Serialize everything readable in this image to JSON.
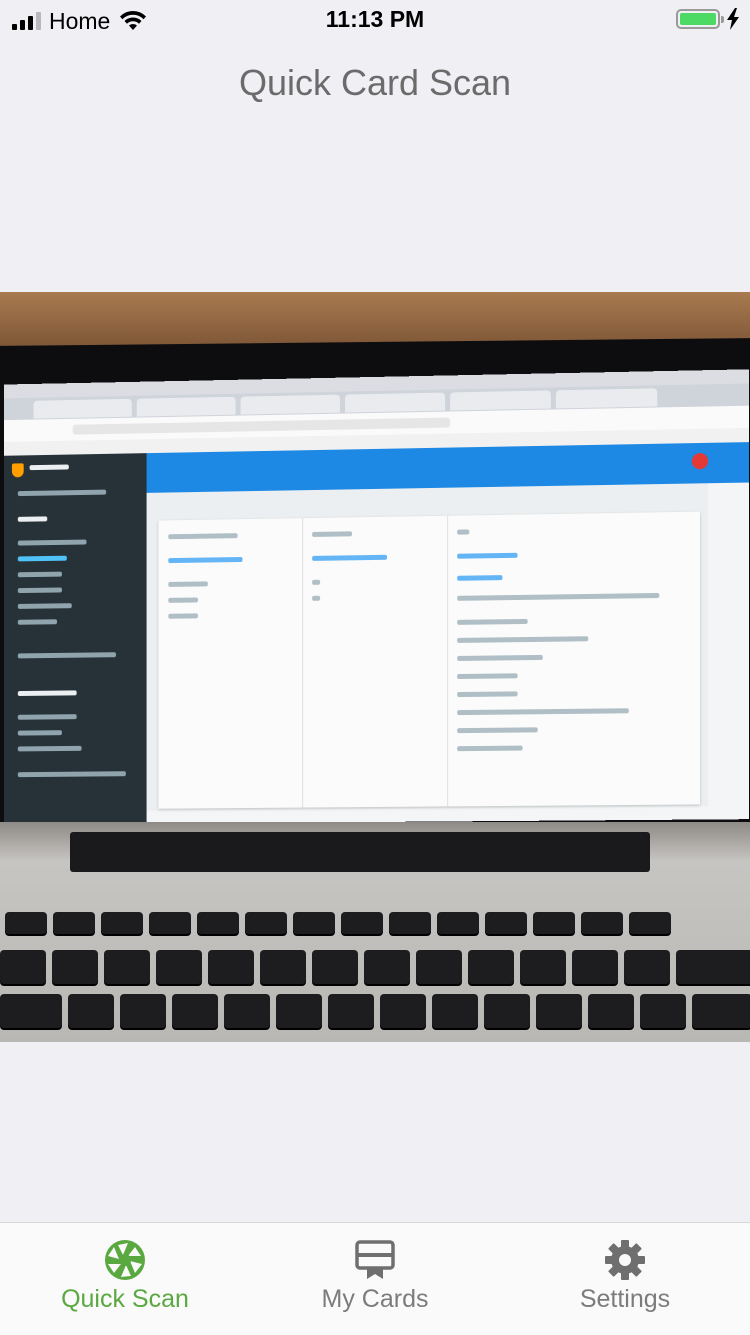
{
  "status_bar": {
    "carrier": "Home",
    "time": "11:13 PM",
    "battery_level": 1.0
  },
  "header": {
    "title": "Quick Card Scan"
  },
  "camera": {
    "icon": "camera-preview"
  },
  "tab_bar": {
    "active_color": "#5aa840",
    "inactive_color": "#7c7c7c",
    "tabs": [
      {
        "label": "Quick Scan",
        "icon": "aperture-icon",
        "active": true
      },
      {
        "label": "My Cards",
        "icon": "cards-icon",
        "active": false
      },
      {
        "label": "Settings",
        "icon": "gear-icon",
        "active": false
      }
    ]
  }
}
